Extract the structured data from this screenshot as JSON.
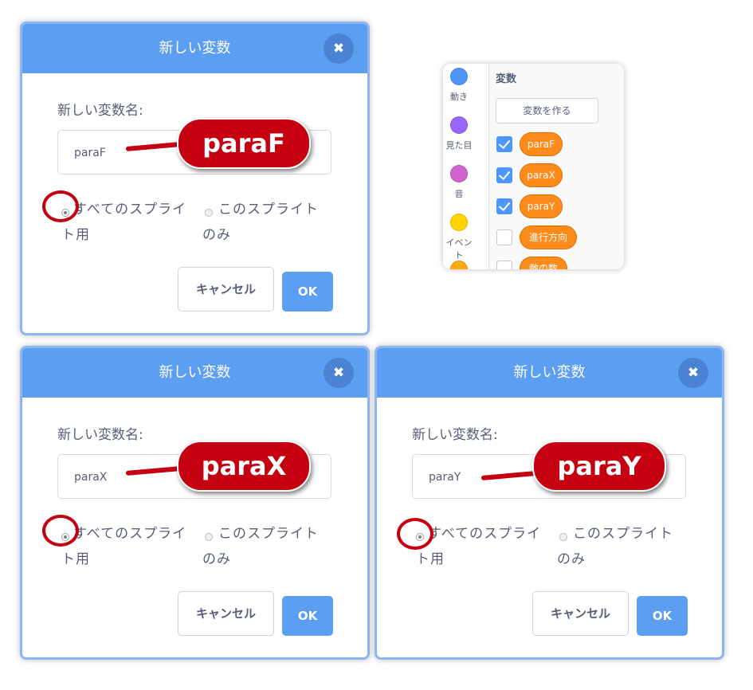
{
  "dialogs": [
    {
      "title": "新しい変数",
      "close_icon": "✖",
      "name_label": "新しい変数名:",
      "input_value": "paraF",
      "option_all_line1": "すべてのスプライ",
      "option_all_line2": "ト用",
      "option_this_line1": "このスプライト",
      "option_this_line2": "のみ",
      "cancel_label": "キャンセル",
      "ok_label": "OK",
      "callout": "paraF"
    },
    {
      "title": "新しい変数",
      "close_icon": "✖",
      "name_label": "新しい変数名:",
      "input_value": "paraX",
      "option_all_line1": "すべてのスプライ",
      "option_all_line2": "ト用",
      "option_this_line1": "このスプライト",
      "option_this_line2": "のみ",
      "cancel_label": "キャンセル",
      "ok_label": "OK",
      "callout": "paraX"
    },
    {
      "title": "新しい変数",
      "close_icon": "✖",
      "name_label": "新しい変数名:",
      "input_value": "paraY",
      "option_all_line1": "すべてのスプライ",
      "option_all_line2": "ト用",
      "option_this_line1": "このスプライト",
      "option_this_line2": "のみ",
      "cancel_label": "キャンセル",
      "ok_label": "OK",
      "callout": "paraY"
    }
  ],
  "palette": {
    "heading": "変数",
    "make_variable_label": "変数を作る",
    "categories": [
      {
        "label": "動き",
        "color": "#4c97ff"
      },
      {
        "label": "見た目",
        "color": "#9966ff"
      },
      {
        "label": "音",
        "color": "#cf63cf"
      },
      {
        "label": "イベント",
        "color": "#ffd500"
      },
      {
        "label": "",
        "color": "#ffab19"
      }
    ],
    "variables": [
      {
        "label": "paraF",
        "checked": true
      },
      {
        "label": "paraX",
        "checked": true
      },
      {
        "label": "paraY",
        "checked": true
      },
      {
        "label": "進行方向",
        "checked": false
      },
      {
        "label": "敵の数",
        "checked": false
      }
    ]
  },
  "colors": {
    "header_blue": "#5c9ef2",
    "callout_red": "#c40011",
    "variable_orange": "#ff8c1a"
  }
}
